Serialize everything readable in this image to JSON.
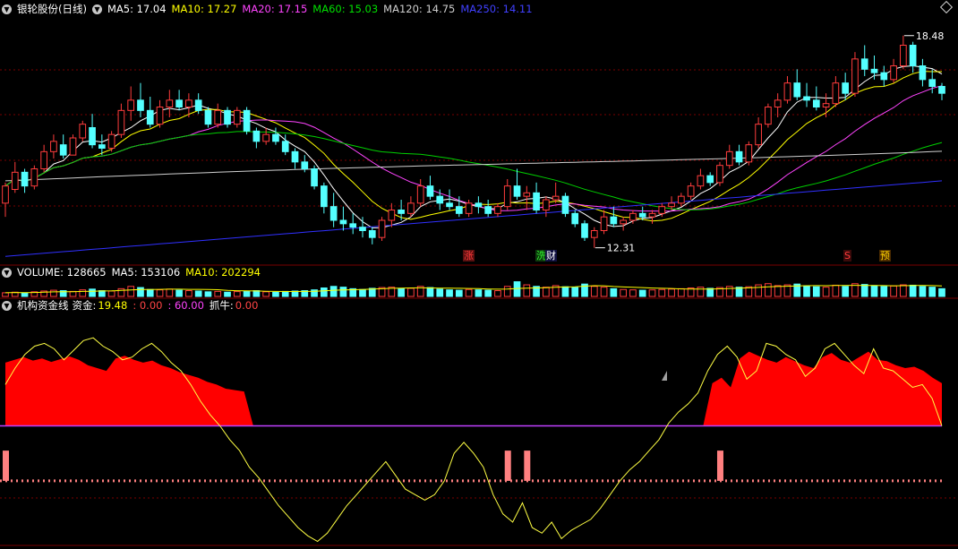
{
  "header": {
    "title": "银轮股份(日线)",
    "ma5": "MA5: 17.04",
    "ma10": "MA10: 17.27",
    "ma20": "MA20: 17.15",
    "ma60": "MA60: 15.03",
    "ma120": "MA120: 14.75",
    "ma250": "MA250: 14.11"
  },
  "volume_header": {
    "volume": "VOLUME: 128665",
    "ma5": "MA5: 153106",
    "ma10": "MA10: 202294"
  },
  "indicator_header": {
    "name": "机构资金线",
    "fund_label": "资金:",
    "fund_value": "19.48",
    "v2": ": 0.00",
    "v3": ": 60.00",
    "catch_label": "抓牛:",
    "catch_value": "0.00"
  },
  "signals": [
    {
      "label": "涨",
      "color": "#ff3b3b",
      "bg": "#5a1010"
    },
    {
      "label": "洗",
      "color": "#33ff33",
      "bg": "#0d3b0d"
    },
    {
      "label": "财",
      "color": "#ffffff",
      "bg": "#101040"
    },
    {
      "label": "S",
      "color": "#ff3b3b",
      "bg": "#3a0a0a"
    },
    {
      "label": "预",
      "color": "#ffd200",
      "bg": "#4a2a00"
    }
  ],
  "annotations": {
    "high": "18.48",
    "low": "12.31"
  },
  "colors": {
    "up": "#ff3c3c",
    "down": "#54ffff",
    "ma5": "#ffffff",
    "ma10": "#ffff00",
    "ma20": "#ff44ff",
    "ma60": "#00d000",
    "ma120": "#d0d0d0",
    "ma250": "#3030ff",
    "grid": "#7a0000",
    "fund_line": "#ffff44",
    "fund_area": "#ff0000",
    "pink": "#ff8080",
    "volma10": "#ffff00"
  },
  "chart_data": {
    "type": "candlestick",
    "title": "银轮股份(日线)",
    "y_range": [
      11.9,
      19.1
    ],
    "volume_range": [
      0,
      440000
    ],
    "indicator_range": [
      -45,
      125
    ],
    "candles": [
      [
        13.6,
        14.2,
        13.2,
        14.1
      ],
      [
        14.0,
        14.8,
        13.9,
        14.5
      ],
      [
        14.5,
        14.6,
        13.9,
        14.1
      ],
      [
        14.1,
        14.7,
        14.0,
        14.6
      ],
      [
        14.6,
        15.3,
        14.5,
        15.1
      ],
      [
        15.1,
        15.6,
        14.9,
        15.4
      ],
      [
        15.3,
        15.6,
        14.9,
        15.0
      ],
      [
        15.0,
        15.6,
        15.0,
        15.5
      ],
      [
        15.5,
        16.0,
        15.4,
        15.9
      ],
      [
        15.8,
        16.2,
        15.2,
        15.3
      ],
      [
        15.3,
        15.6,
        15.0,
        15.2
      ],
      [
        15.2,
        15.7,
        15.1,
        15.6
      ],
      [
        15.6,
        16.5,
        15.5,
        16.3
      ],
      [
        16.3,
        17.0,
        16.0,
        16.6
      ],
      [
        16.6,
        17.1,
        16.1,
        16.3
      ],
      [
        16.3,
        16.7,
        15.8,
        15.9
      ],
      [
        15.9,
        16.6,
        15.8,
        16.4
      ],
      [
        16.4,
        16.9,
        16.1,
        16.6
      ],
      [
        16.6,
        16.9,
        16.3,
        16.4
      ],
      [
        16.4,
        16.8,
        16.1,
        16.6
      ],
      [
        16.6,
        16.8,
        16.2,
        16.3
      ],
      [
        16.3,
        16.4,
        15.8,
        15.9
      ],
      [
        15.9,
        16.5,
        15.8,
        16.3
      ],
      [
        16.3,
        16.4,
        15.8,
        15.9
      ],
      [
        15.9,
        16.4,
        15.8,
        16.3
      ],
      [
        16.3,
        16.4,
        15.6,
        15.7
      ],
      [
        15.7,
        15.8,
        15.2,
        15.4
      ],
      [
        15.4,
        15.8,
        15.3,
        15.6
      ],
      [
        15.6,
        15.8,
        15.3,
        15.4
      ],
      [
        15.4,
        15.6,
        15.0,
        15.1
      ],
      [
        15.1,
        15.2,
        14.6,
        14.8
      ],
      [
        14.8,
        15.0,
        14.5,
        14.6
      ],
      [
        14.6,
        14.7,
        14.0,
        14.1
      ],
      [
        14.1,
        14.2,
        13.3,
        13.5
      ],
      [
        13.5,
        13.9,
        12.9,
        13.1
      ],
      [
        13.1,
        13.5,
        12.8,
        13.0
      ],
      [
        13.0,
        13.3,
        12.7,
        12.9
      ],
      [
        12.9,
        13.2,
        12.6,
        12.8
      ],
      [
        12.8,
        12.9,
        12.4,
        12.6
      ],
      [
        12.6,
        13.2,
        12.5,
        13.1
      ],
      [
        13.1,
        13.6,
        12.9,
        13.4
      ],
      [
        13.4,
        13.7,
        13.1,
        13.3
      ],
      [
        13.3,
        13.8,
        13.2,
        13.6
      ],
      [
        13.6,
        14.3,
        13.5,
        14.1
      ],
      [
        14.1,
        14.4,
        13.7,
        13.8
      ],
      [
        13.8,
        14.0,
        13.4,
        13.6
      ],
      [
        13.6,
        14.0,
        13.4,
        13.5
      ],
      [
        13.5,
        13.8,
        13.2,
        13.3
      ],
      [
        13.3,
        13.7,
        13.2,
        13.6
      ],
      [
        13.6,
        13.8,
        13.3,
        13.5
      ],
      [
        13.5,
        13.7,
        13.2,
        13.3
      ],
      [
        13.3,
        13.6,
        13.2,
        13.5
      ],
      [
        13.5,
        14.3,
        13.4,
        14.1
      ],
      [
        14.1,
        14.6,
        13.7,
        13.8
      ],
      [
        13.8,
        14.1,
        13.4,
        13.9
      ],
      [
        13.9,
        14.2,
        13.3,
        13.4
      ],
      [
        13.4,
        13.8,
        13.2,
        13.7
      ],
      [
        13.7,
        14.2,
        13.6,
        13.8
      ],
      [
        13.8,
        13.9,
        13.2,
        13.3
      ],
      [
        13.3,
        13.4,
        12.9,
        13.0
      ],
      [
        13.0,
        13.1,
        12.5,
        12.6
      ],
      [
        12.6,
        12.9,
        12.3,
        12.8
      ],
      [
        12.8,
        13.4,
        12.7,
        13.2
      ],
      [
        13.2,
        13.5,
        12.9,
        13.0
      ],
      [
        13.0,
        13.2,
        12.8,
        13.1
      ],
      [
        13.1,
        13.4,
        13.0,
        13.3
      ],
      [
        13.3,
        13.5,
        13.1,
        13.2
      ],
      [
        13.2,
        13.4,
        13.0,
        13.3
      ],
      [
        13.3,
        13.6,
        13.2,
        13.5
      ],
      [
        13.5,
        13.8,
        13.4,
        13.6
      ],
      [
        13.6,
        13.9,
        13.5,
        13.8
      ],
      [
        13.8,
        14.2,
        13.7,
        14.1
      ],
      [
        14.1,
        14.6,
        14.0,
        14.4
      ],
      [
        14.4,
        14.5,
        14.1,
        14.2
      ],
      [
        14.2,
        14.8,
        14.1,
        14.7
      ],
      [
        14.7,
        15.3,
        14.6,
        15.1
      ],
      [
        15.1,
        15.3,
        14.7,
        14.8
      ],
      [
        14.8,
        15.4,
        14.7,
        15.3
      ],
      [
        15.3,
        16.1,
        15.2,
        15.9
      ],
      [
        15.9,
        16.5,
        15.8,
        16.4
      ],
      [
        16.4,
        16.8,
        16.1,
        16.6
      ],
      [
        16.6,
        17.3,
        16.5,
        17.1
      ],
      [
        17.1,
        17.5,
        16.6,
        16.7
      ],
      [
        16.7,
        17.1,
        16.4,
        16.6
      ],
      [
        16.6,
        17.0,
        16.3,
        16.4
      ],
      [
        16.4,
        16.8,
        16.1,
        16.5
      ],
      [
        16.5,
        17.3,
        16.4,
        17.1
      ],
      [
        17.1,
        17.4,
        16.6,
        16.8
      ],
      [
        16.8,
        18.0,
        16.7,
        17.8
      ],
      [
        17.8,
        18.2,
        17.3,
        17.5
      ],
      [
        17.5,
        17.9,
        17.2,
        17.4
      ],
      [
        17.4,
        17.6,
        17.0,
        17.2
      ],
      [
        17.2,
        17.8,
        17.1,
        17.6
      ],
      [
        17.6,
        18.48,
        17.5,
        18.2
      ],
      [
        18.2,
        18.3,
        17.4,
        17.6
      ],
      [
        17.6,
        17.8,
        17.0,
        17.2
      ],
      [
        17.2,
        17.5,
        16.8,
        17.0
      ],
      [
        17.0,
        17.1,
        16.6,
        16.8
      ]
    ],
    "volume": [
      95000,
      110000,
      85000,
      120000,
      140000,
      160000,
      150000,
      130000,
      170000,
      190000,
      150000,
      140000,
      200000,
      260000,
      230000,
      180000,
      170000,
      190000,
      160000,
      150000,
      140000,
      120000,
      130000,
      110000,
      125000,
      140000,
      150000,
      120000,
      110000,
      130000,
      140000,
      150000,
      170000,
      220000,
      260000,
      240000,
      200000,
      180000,
      210000,
      230000,
      240000,
      200000,
      210000,
      260000,
      230000,
      190000,
      170000,
      160000,
      180000,
      170000,
      160000,
      150000,
      260000,
      380000,
      300000,
      260000,
      240000,
      280000,
      250000,
      230000,
      320000,
      260000,
      240000,
      200000,
      180000,
      170000,
      160000,
      170000,
      180000,
      190000,
      200000,
      220000,
      240000,
      210000,
      230000,
      260000,
      240000,
      250000,
      300000,
      330000,
      280000,
      300000,
      320000,
      270000,
      250000,
      240000,
      290000,
      260000,
      330000,
      310000,
      280000,
      260000,
      270000,
      300000,
      290000,
      260000,
      240000,
      200000
    ],
    "fund_line": [
      70,
      82,
      92,
      98,
      100,
      96,
      88,
      95,
      102,
      104,
      98,
      94,
      88,
      90,
      96,
      100,
      94,
      86,
      80,
      70,
      58,
      48,
      40,
      30,
      22,
      10,
      2,
      -8,
      -18,
      -26,
      -34,
      -40,
      -44,
      -38,
      -28,
      -18,
      -10,
      -2,
      6,
      14,
      4,
      -6,
      -10,
      -14,
      -10,
      0,
      20,
      28,
      20,
      10,
      -10,
      -24,
      -30,
      -16,
      -34,
      -38,
      -30,
      -42,
      -36,
      -32,
      -28,
      -20,
      -10,
      0,
      8,
      14,
      22,
      30,
      42,
      50,
      56,
      64,
      80,
      92,
      98,
      90,
      74,
      80,
      100,
      98,
      92,
      88,
      76,
      82,
      96,
      100,
      92,
      84,
      78,
      96,
      82,
      80,
      74,
      68,
      70,
      60,
      40
    ],
    "fund_area": [
      92,
      96,
      100,
      95,
      98,
      93,
      97,
      101,
      96,
      88,
      84,
      80,
      98,
      102,
      96,
      92,
      95,
      88,
      84,
      78,
      74,
      70,
      64,
      60,
      54,
      52,
      50,
      0,
      0,
      0,
      0,
      0,
      0,
      0,
      0,
      0,
      0,
      0,
      0,
      0,
      0,
      0,
      0,
      0,
      0,
      0,
      0,
      0,
      0,
      0,
      0,
      0,
      0,
      0,
      0,
      0,
      0,
      0,
      0,
      0,
      0,
      0,
      0,
      0,
      0,
      0,
      0,
      0,
      0,
      0,
      0,
      0,
      0,
      0,
      0,
      0,
      0,
      62,
      70,
      56,
      98,
      108,
      102,
      96,
      92,
      100,
      94,
      88,
      84,
      100,
      106,
      96,
      92,
      100,
      108,
      96,
      94,
      88,
      84,
      86,
      80,
      70,
      62
    ],
    "signal_bars": [
      0,
      52,
      54,
      74
    ]
  }
}
